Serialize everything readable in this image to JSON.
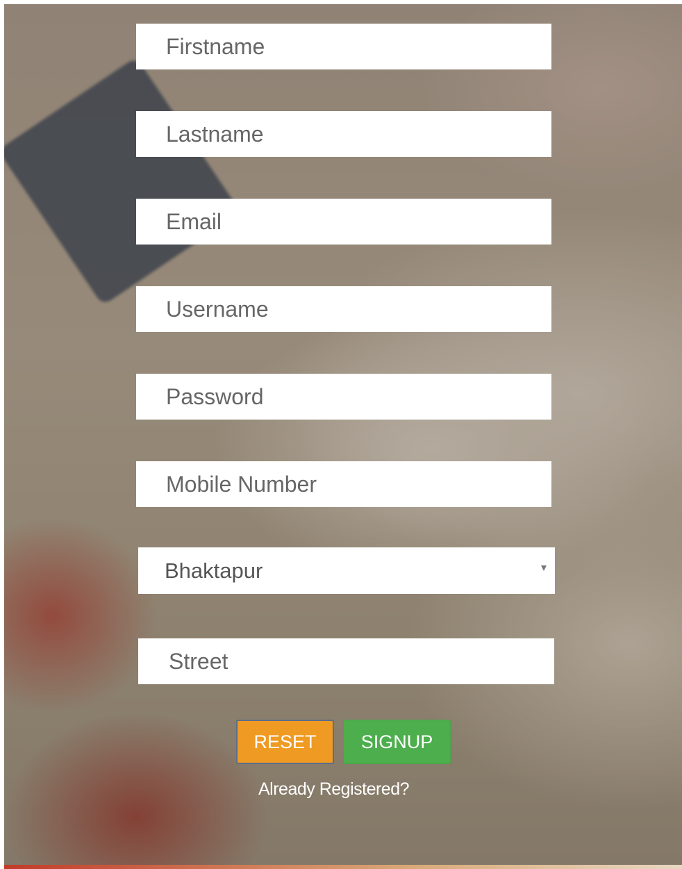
{
  "form": {
    "firstname": {
      "placeholder": "Firstname"
    },
    "lastname": {
      "placeholder": "Lastname"
    },
    "email": {
      "placeholder": "Email"
    },
    "username": {
      "placeholder": "Username"
    },
    "password": {
      "placeholder": "Password"
    },
    "mobile": {
      "placeholder": "Mobile Number"
    },
    "city": {
      "selected": "Bhaktapur",
      "icon": "chevron-down-icon"
    },
    "street": {
      "placeholder": "Street"
    }
  },
  "buttons": {
    "reset": "RESET",
    "signup": "SIGNUP"
  },
  "links": {
    "already_registered": "Already Registered?"
  },
  "colors": {
    "reset_bg": "#ef9a23",
    "signup_bg": "#4cae4c",
    "field_bg": "#ffffff",
    "link_text": "#ffffff"
  }
}
